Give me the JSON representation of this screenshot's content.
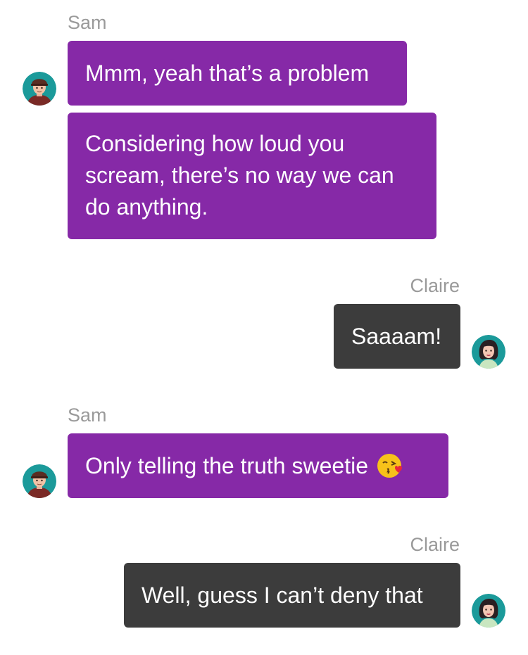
{
  "messages": [
    {
      "sender": "Sam",
      "bubbles": [
        "Mmm, yeah that’s a problem",
        "Considering how loud you scream, there’s no way we can do anything."
      ]
    },
    {
      "sender": "Claire",
      "bubbles": [
        "Saaaam!"
      ]
    },
    {
      "sender": "Sam",
      "bubbles": [
        "Only telling the truth sweetie"
      ],
      "emoji": "face-blowing-kiss-emoji"
    },
    {
      "sender": "Claire",
      "bubbles": [
        "Well, guess I can’t deny that"
      ]
    }
  ],
  "colors": {
    "sam_bubble": "#8629a7",
    "claire_bubble": "#3c3c3c",
    "sender_name": "#9a9a9a",
    "bubble_text": "#ffffff",
    "avatar_ring": "#1b9a9a"
  },
  "avatars": {
    "sam": "male-avatar-with-cap",
    "claire": "female-avatar-dark-hair"
  }
}
